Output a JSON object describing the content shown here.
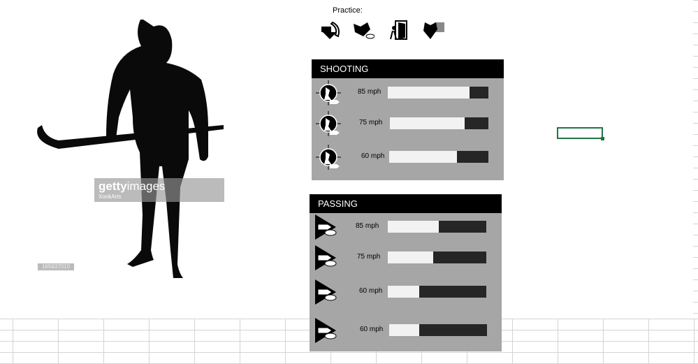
{
  "practice_label": "Practice:",
  "practice_icons": [
    "stickhandling-icon",
    "puck-battle-icon",
    "exit-door-icon",
    "goalie-icon"
  ],
  "watermark": {
    "brand_bold": "getty",
    "brand_light": "images",
    "credit": "XonkArts",
    "image_id": "165637010"
  },
  "shooting": {
    "title": "SHOOTING",
    "rows": [
      {
        "icon": "slapshot-icon",
        "label": "85 mph",
        "fraction": 0.81
      },
      {
        "icon": "wristshot-icon",
        "label": "75 mph",
        "fraction": 0.76
      },
      {
        "icon": "snapshot-icon",
        "label": "60 mph",
        "fraction": 0.68
      }
    ]
  },
  "passing": {
    "title": "PASSING",
    "rows": [
      {
        "icon": "direct-pass-icon",
        "label": "85 mph",
        "fraction": 0.52
      },
      {
        "icon": "saucer-pass-icon",
        "label": "75 mph",
        "fraction": 0.46
      },
      {
        "icon": "bank-pass-icon",
        "label": "60 mph",
        "fraction": 0.32
      },
      {
        "icon": "drop-pass-icon",
        "label": "60 mph",
        "fraction": 0.31
      }
    ]
  },
  "colors": {
    "panel": "#a6a6a6",
    "bar_bg": "#262626",
    "bar_fill": "#f2f2f2",
    "selection": "#217346"
  }
}
